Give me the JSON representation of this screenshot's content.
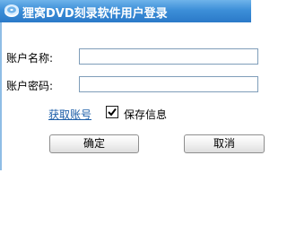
{
  "window": {
    "title": "狸窝DVD刻录软件用户登录",
    "logo_icon": "dvd-disc-icon"
  },
  "form": {
    "username_label": "账户名称:",
    "username_value": "",
    "password_label": "账户密码:",
    "password_value": "",
    "get_account_link": "获取账号",
    "save_info_label": "保存信息",
    "save_info_checked": true
  },
  "buttons": {
    "ok_label": "确定",
    "cancel_label": "取消"
  },
  "colors": {
    "title_bar": "#3d8fd8",
    "link": "#1c5ea8"
  }
}
